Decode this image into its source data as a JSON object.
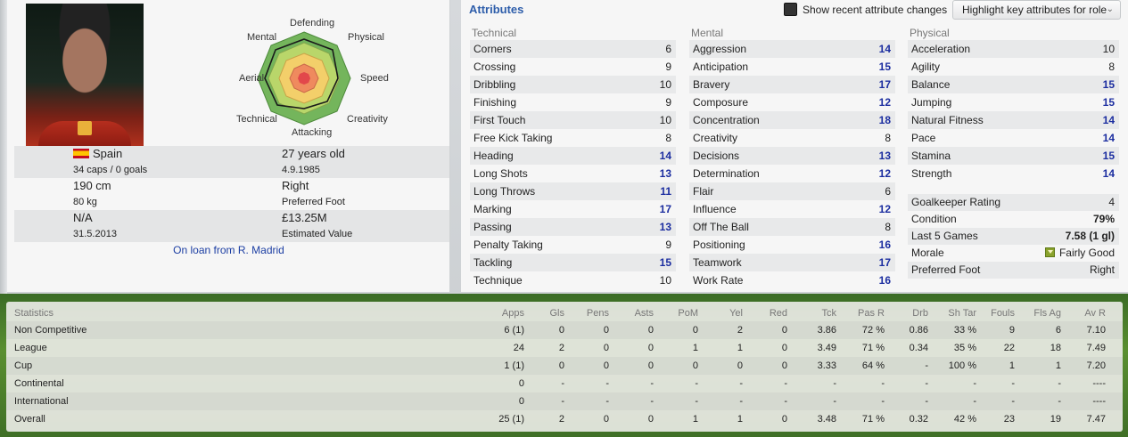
{
  "profile": {
    "radar_labels": {
      "defending": "Defending",
      "physical": "Physical",
      "speed": "Speed",
      "creativity": "Creativity",
      "attacking": "Attacking",
      "technical": "Technical",
      "aerial": "Aerial",
      "mental": "Mental"
    },
    "nationality": "Spain",
    "caps": "34 caps / 0 goals",
    "age": "27 years old",
    "dob": "4.9.1985",
    "height": "190 cm",
    "foot": "Right",
    "weight": "80 kg",
    "foot_label": "Preferred Foot",
    "contract": "N/A",
    "value": "£13.25M",
    "contract_date": "31.5.2013",
    "value_label": "Estimated Value",
    "loan": "On loan from R. Madrid"
  },
  "attributes": {
    "title": "Attributes",
    "show_changes": "Show recent attribute changes",
    "highlight_button": "Highlight key attributes for role",
    "technical": {
      "heading": "Technical",
      "items": [
        {
          "name": "Corners",
          "value": "6",
          "hi": false
        },
        {
          "name": "Crossing",
          "value": "9",
          "hi": false
        },
        {
          "name": "Dribbling",
          "value": "10",
          "hi": false
        },
        {
          "name": "Finishing",
          "value": "9",
          "hi": false
        },
        {
          "name": "First Touch",
          "value": "10",
          "hi": false
        },
        {
          "name": "Free Kick Taking",
          "value": "8",
          "hi": false
        },
        {
          "name": "Heading",
          "value": "14",
          "hi": true
        },
        {
          "name": "Long Shots",
          "value": "13",
          "hi": true
        },
        {
          "name": "Long Throws",
          "value": "11",
          "hi": true
        },
        {
          "name": "Marking",
          "value": "17",
          "hi": true
        },
        {
          "name": "Passing",
          "value": "13",
          "hi": true
        },
        {
          "name": "Penalty Taking",
          "value": "9",
          "hi": false
        },
        {
          "name": "Tackling",
          "value": "15",
          "hi": true
        },
        {
          "name": "Technique",
          "value": "10",
          "hi": false
        }
      ]
    },
    "mental": {
      "heading": "Mental",
      "items": [
        {
          "name": "Aggression",
          "value": "14",
          "hi": true
        },
        {
          "name": "Anticipation",
          "value": "15",
          "hi": true
        },
        {
          "name": "Bravery",
          "value": "17",
          "hi": true
        },
        {
          "name": "Composure",
          "value": "12",
          "hi": true
        },
        {
          "name": "Concentration",
          "value": "18",
          "hi": true
        },
        {
          "name": "Creativity",
          "value": "8",
          "hi": false
        },
        {
          "name": "Decisions",
          "value": "13",
          "hi": true
        },
        {
          "name": "Determination",
          "value": "12",
          "hi": true
        },
        {
          "name": "Flair",
          "value": "6",
          "hi": false
        },
        {
          "name": "Influence",
          "value": "12",
          "hi": true
        },
        {
          "name": "Off The Ball",
          "value": "8",
          "hi": false
        },
        {
          "name": "Positioning",
          "value": "16",
          "hi": true
        },
        {
          "name": "Teamwork",
          "value": "17",
          "hi": true
        },
        {
          "name": "Work Rate",
          "value": "16",
          "hi": true
        }
      ]
    },
    "physical": {
      "heading": "Physical",
      "items": [
        {
          "name": "Acceleration",
          "value": "10",
          "hi": false
        },
        {
          "name": "Agility",
          "value": "8",
          "hi": false
        },
        {
          "name": "Balance",
          "value": "15",
          "hi": true
        },
        {
          "name": "Jumping",
          "value": "15",
          "hi": true
        },
        {
          "name": "Natural Fitness",
          "value": "14",
          "hi": true
        },
        {
          "name": "Pace",
          "value": "14",
          "hi": true
        },
        {
          "name": "Stamina",
          "value": "15",
          "hi": true
        },
        {
          "name": "Strength",
          "value": "14",
          "hi": true
        }
      ]
    },
    "extra": [
      {
        "name": "Goalkeeper Rating",
        "value": "4"
      },
      {
        "name": "Condition",
        "value": "79%"
      },
      {
        "name": "Last 5 Games",
        "value": "7.58 (1 gl)"
      },
      {
        "name": "Morale",
        "value": "Fairly Good"
      },
      {
        "name": "Preferred Foot",
        "value": "Right"
      }
    ]
  },
  "stats": {
    "headers": [
      "Statistics",
      "Apps",
      "Gls",
      "Pens",
      "Asts",
      "PoM",
      "Yel",
      "Red",
      "Tck",
      "Pas R",
      "Drb",
      "Sh Tar",
      "Fouls",
      "Fls Ag",
      "Av R"
    ],
    "rows": [
      [
        "Non Competitive",
        "6 (1)",
        "0",
        "0",
        "0",
        "0",
        "2",
        "0",
        "3.86",
        "72 %",
        "0.86",
        "33 %",
        "9",
        "6",
        "7.10"
      ],
      [
        "League",
        "24",
        "2",
        "0",
        "0",
        "1",
        "1",
        "0",
        "3.49",
        "71 %",
        "0.34",
        "35 %",
        "22",
        "18",
        "7.49"
      ],
      [
        "Cup",
        "1 (1)",
        "0",
        "0",
        "0",
        "0",
        "0",
        "0",
        "3.33",
        "64 %",
        "-",
        "100 %",
        "1",
        "1",
        "7.20"
      ],
      [
        "Continental",
        "0",
        "-",
        "-",
        "-",
        "-",
        "-",
        "-",
        "-",
        "-",
        "-",
        "-",
        "-",
        "-",
        "----"
      ],
      [
        "International",
        "0",
        "-",
        "-",
        "-",
        "-",
        "-",
        "-",
        "-",
        "-",
        "-",
        "-",
        "-",
        "-",
        "----"
      ],
      [
        "Overall",
        "25 (1)",
        "2",
        "0",
        "0",
        "1",
        "1",
        "0",
        "3.48",
        "71 %",
        "0.32",
        "42 %",
        "23",
        "19",
        "7.47"
      ]
    ]
  }
}
